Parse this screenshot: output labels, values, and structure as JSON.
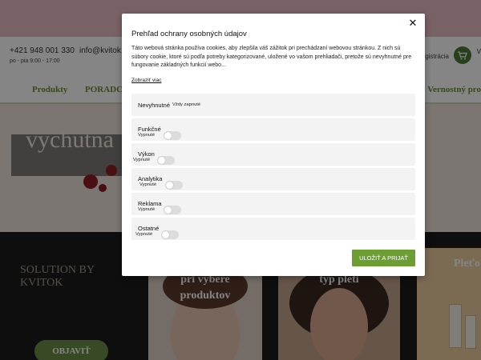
{
  "site": {
    "phone": "+421 948 001 330",
    "hours": "po - pia 9:00 - 17:00",
    "email": "info@kvitok.",
    "register_fragment": "gistrácia",
    "cart_label_fragment": "V",
    "cart_icon": "cart-icon",
    "nav": [
      "Produkty",
      "PORADCA",
      "Vernostný pro"
    ],
    "hero_word": "vychutna",
    "promo_title": "SOLUTION BY KVITOK",
    "promo_button": "OBJAVIŤ",
    "card_a_title": "pri výbere produktov",
    "card_b_title": "typ pleti",
    "card_c_title": "Pleťo krém"
  },
  "modal": {
    "title": "Prehľad ochrany osobných údajov",
    "close": "✕",
    "description": "Táto webová stránka používa cookies, aby zlepšila váš zážitok pri prechádzaní webovou stránkou. Z nich sú súbory cookie, ktoré sú podľa potreby kategorizované, uložené vo vašom prehliadači, pretože sú nevyhnutné pre fungovanie základných funkcií webo...",
    "show_more": "Zobraziť viac",
    "categories": [
      {
        "name": "Nevyhnutné",
        "status": "Vždy zapnuté"
      },
      {
        "name": "Funkčné",
        "status": "Vypnuté"
      },
      {
        "name": "Výkon",
        "status": "Vypnuté"
      },
      {
        "name": "Analytika",
        "status": "Vypnuté"
      },
      {
        "name": "Reklama",
        "status": "Vypnuté"
      },
      {
        "name": "Ostatné",
        "status": "Vypnuté"
      }
    ],
    "accept_button": "ULOŽIŤ A PRIJAŤ"
  },
  "colors": {
    "accent_green": "#6d9e31",
    "header_pink": "#e9bcc4",
    "nav_green": "#6c8d3a"
  }
}
